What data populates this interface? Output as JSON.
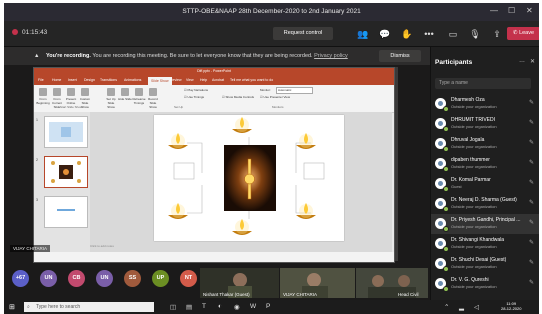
{
  "window": {
    "title": "STTP-OBE&NAAP 28th December-2020 to 2nd January 2021",
    "controls": [
      "—",
      "☐",
      "✕"
    ]
  },
  "toolbar": {
    "timer": "01:15:43",
    "request_control": "Request control",
    "leave": "Leave",
    "leave_icon": "phone-icon",
    "icons": [
      {
        "name": "people-icon",
        "glyph": "👥",
        "label": "Participants"
      },
      {
        "name": "chat-icon",
        "glyph": "💬",
        "label": "Chat"
      },
      {
        "name": "raise-hand-icon",
        "glyph": "✋",
        "label": "Raise hand"
      },
      {
        "name": "more-icon",
        "glyph": "•••",
        "label": "More"
      },
      {
        "name": "camera-icon",
        "glyph": "▭",
        "label": "Camera"
      },
      {
        "name": "mic-icon",
        "glyph": "🎙",
        "label": "Mic"
      },
      {
        "name": "share-icon",
        "glyph": "⇪",
        "label": "Share"
      }
    ]
  },
  "banner": {
    "bold": "You're recording.",
    "text": " You are recording this meeting. Be sure to let everyone know that they are being recorded.",
    "link": "Privacy policy",
    "dismiss": "Dismiss"
  },
  "powerpoint": {
    "title": "Diff.pptx  -  PowerPoint",
    "tabs": [
      "File",
      "Home",
      "Insert",
      "Design",
      "Transitions",
      "Animations",
      "Slide Show",
      "Review",
      "View",
      "Help",
      "Acrobat",
      "Tell me what you want to do"
    ],
    "active_tab_index": 6,
    "ribbon_items": [
      "From Beginning",
      "From Current Slide",
      "Present Online",
      "Custom Slide Show",
      "Set Up Slide Show",
      "Hide Slide",
      "Rehearse Timings",
      "Record Slide Show"
    ],
    "ribbon_groups": [
      "Start Slide Show",
      "Set Up",
      "Monitors"
    ],
    "checks": [
      "Play Narrations",
      "Use Timings",
      "Show Media Controls",
      "Use Presenter View"
    ],
    "monitor_label": "Monitor:",
    "monitor_value": "Automatic",
    "notes_placeholder": "Click to add notes",
    "thumbnail_numbers": [
      "1",
      "2",
      "3"
    ]
  },
  "presenter_name": "VIJAY CHITARIA",
  "gallery": {
    "avatars": [
      {
        "text": "+67",
        "color": "#5b5fc7"
      },
      {
        "text": "UN",
        "color": "#7a5ea8"
      },
      {
        "text": "CB",
        "color": "#c24a6e"
      },
      {
        "text": "UN",
        "color": "#7a5ea8"
      },
      {
        "text": "SS",
        "color": "#a05a3c"
      },
      {
        "text": "UP",
        "color": "#6b8e23"
      },
      {
        "text": "NT",
        "color": "#d35b4a"
      }
    ],
    "videos": [
      "Nishant Thakar (Guest)",
      "VIJAY CHITARIA",
      "Head Civil"
    ]
  },
  "participants": {
    "title": "Participants",
    "search_placeholder": "Type a name",
    "list": [
      {
        "name": "Dharmesh Oza",
        "sub": "Outside your organization"
      },
      {
        "name": "DHRUMIT TRIVEDI",
        "sub": "Outside your organization"
      },
      {
        "name": "Dhruval Jogala",
        "sub": "Outside your organization"
      },
      {
        "name": "dipaben thummer",
        "sub": "Outside your organization"
      },
      {
        "name": "Dr. Komal Parmar",
        "sub": "Guest"
      },
      {
        "name": "Dr. Neeraj D. Sharma (Guest)",
        "sub": "Outside your organization"
      },
      {
        "name": "Dr. Priyesh Gandhi, Principal ...",
        "sub": "Outside your organization"
      },
      {
        "name": "Dr. Shivangi Khandwala",
        "sub": "Outside your organization"
      },
      {
        "name": "Dr. Shuchi Desai (Guest)",
        "sub": "Outside your organization"
      },
      {
        "name": "Dr. V. G. Qureshi",
        "sub": "Outside your organization"
      }
    ]
  },
  "taskbar": {
    "search_placeholder": "Type here to search",
    "time": "11:09",
    "date": "28-12-2020"
  }
}
